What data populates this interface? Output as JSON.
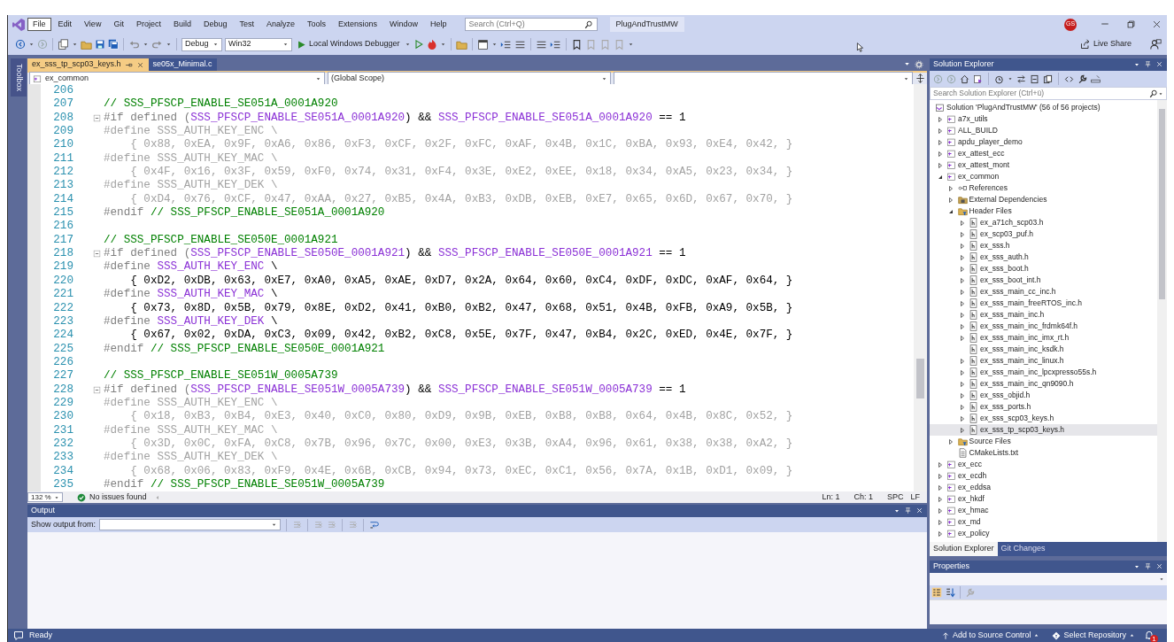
{
  "window": {
    "solution_name": "PlugAndTrustMW",
    "account_initials": "GS"
  },
  "menu": [
    {
      "label": "File",
      "selected": true
    },
    {
      "label": "Edit",
      "selected": false
    },
    {
      "label": "View",
      "selected": false
    },
    {
      "label": "Git",
      "selected": false
    },
    {
      "label": "Project",
      "selected": false
    },
    {
      "label": "Build",
      "selected": false
    },
    {
      "label": "Debug",
      "selected": false
    },
    {
      "label": "Test",
      "selected": false
    },
    {
      "label": "Analyze",
      "selected": false
    },
    {
      "label": "Tools",
      "selected": false
    },
    {
      "label": "Extensions",
      "selected": false
    },
    {
      "label": "Window",
      "selected": false
    },
    {
      "label": "Help",
      "selected": false
    }
  ],
  "search": {
    "placeholder": "Search (Ctrl+Q)"
  },
  "toolbar": {
    "configuration": "Debug",
    "platform": "Win32",
    "run_label": "Local Windows Debugger",
    "live_share": "Live Share"
  },
  "toolbox": {
    "label": "Toolbox"
  },
  "editor": {
    "tabs": [
      {
        "label": "ex_sss_tp_scp03_keys.h",
        "selected": true
      },
      {
        "label": "se05x_Minimal.c",
        "selected": false
      }
    ],
    "navigation": {
      "project": "ex_common",
      "scope": "(Global Scope)"
    },
    "lines": [
      {
        "number": "206",
        "fold": false
      },
      {
        "number": "207",
        "fold": false,
        "segments": [
          {
            "kind": "comment",
            "text": "// SSS_PFSCP_ENABLE_SE051A_0001A920"
          }
        ]
      },
      {
        "number": "208",
        "fold": true,
        "segments": [
          {
            "kind": "directive",
            "text": "#if defined ("
          },
          {
            "kind": "macro",
            "text": "SSS_PFSCP_ENABLE_SE051A_0001A920"
          },
          {
            "kind": "plain",
            "text": ") && "
          },
          {
            "kind": "macro",
            "text": "SSS_PFSCP_ENABLE_SE051A_0001A920"
          },
          {
            "kind": "plain",
            "text": " == 1"
          }
        ]
      },
      {
        "number": "209",
        "fold": false,
        "segments": [
          {
            "kind": "inactive",
            "text": "#define SSS_AUTH_KEY_ENC \\"
          }
        ]
      },
      {
        "number": "210",
        "fold": false,
        "segments": [
          {
            "kind": "inactive",
            "text": "    { 0x88, 0xEA, 0x9F, 0xA6, 0x86, 0xF3, 0xCF, 0x2F, 0xFC, 0xAF, 0x4B, 0x1C, 0xBA, 0x93, 0xE4, 0x42, }"
          }
        ]
      },
      {
        "number": "211",
        "fold": false,
        "segments": [
          {
            "kind": "inactive",
            "text": "#define SSS_AUTH_KEY_MAC \\"
          }
        ]
      },
      {
        "number": "212",
        "fold": false,
        "segments": [
          {
            "kind": "inactive",
            "text": "    { 0x4F, 0x16, 0x3F, 0x59, 0xF0, 0x74, 0x31, 0xF4, 0x3E, 0xE2, 0xEE, 0x18, 0x34, 0xA5, 0x23, 0x34, }"
          }
        ]
      },
      {
        "number": "213",
        "fold": false,
        "segments": [
          {
            "kind": "inactive",
            "text": "#define SSS_AUTH_KEY_DEK \\"
          }
        ]
      },
      {
        "number": "214",
        "fold": false,
        "segments": [
          {
            "kind": "inactive",
            "text": "    { 0xD4, 0x76, 0xCF, 0x47, 0xAA, 0x27, 0xB5, 0x4A, 0xB3, 0xDB, 0xEB, 0xE7, 0x65, 0x6D, 0x67, 0x70, }"
          }
        ]
      },
      {
        "number": "215",
        "fold": false,
        "segments": [
          {
            "kind": "directive",
            "text": "#endif "
          },
          {
            "kind": "comment",
            "text": "// SSS_PFSCP_ENABLE_SE051A_0001A920"
          }
        ]
      },
      {
        "number": "216",
        "fold": false
      },
      {
        "number": "217",
        "fold": false,
        "segments": [
          {
            "kind": "comment",
            "text": "// SSS_PFSCP_ENABLE_SE050E_0001A921"
          }
        ]
      },
      {
        "number": "218",
        "fold": true,
        "segments": [
          {
            "kind": "directive",
            "text": "#if defined ("
          },
          {
            "kind": "macro",
            "text": "SSS_PFSCP_ENABLE_SE050E_0001A921"
          },
          {
            "kind": "plain",
            "text": ") && "
          },
          {
            "kind": "macro",
            "text": "SSS_PFSCP_ENABLE_SE050E_0001A921"
          },
          {
            "kind": "plain",
            "text": " == 1"
          }
        ]
      },
      {
        "number": "219",
        "fold": false,
        "segments": [
          {
            "kind": "directive",
            "text": "#define "
          },
          {
            "kind": "macro",
            "text": "SSS_AUTH_KEY_ENC"
          },
          {
            "kind": "plain",
            "text": " \\"
          }
        ]
      },
      {
        "number": "220",
        "fold": false,
        "segments": [
          {
            "kind": "plain",
            "text": "    { 0xD2, 0xDB, 0x63, 0xE7, 0xA0, 0xA5, 0xAE, 0xD7, 0x2A, 0x64, 0x60, 0xC4, 0xDF, 0xDC, 0xAF, 0x64, }"
          }
        ]
      },
      {
        "number": "221",
        "fold": false,
        "segments": [
          {
            "kind": "directive",
            "text": "#define "
          },
          {
            "kind": "macro",
            "text": "SSS_AUTH_KEY_MAC"
          },
          {
            "kind": "plain",
            "text": " \\"
          }
        ]
      },
      {
        "number": "222",
        "fold": false,
        "segments": [
          {
            "kind": "plain",
            "text": "    { 0x73, 0x8D, 0x5B, 0x79, 0x8E, 0xD2, 0x41, 0xB0, 0xB2, 0x47, 0x68, 0x51, 0x4B, 0xFB, 0xA9, 0x5B, }"
          }
        ]
      },
      {
        "number": "223",
        "fold": false,
        "segments": [
          {
            "kind": "directive",
            "text": "#define "
          },
          {
            "kind": "macro",
            "text": "SSS_AUTH_KEY_DEK"
          },
          {
            "kind": "plain",
            "text": " \\"
          }
        ]
      },
      {
        "number": "224",
        "fold": false,
        "segments": [
          {
            "kind": "plain",
            "text": "    { 0x67, 0x02, 0xDA, 0xC3, 0x09, 0x42, 0xB2, 0xC8, 0x5E, 0x7F, 0x47, 0xB4, 0x2C, 0xED, 0x4E, 0x7F, }"
          }
        ]
      },
      {
        "number": "225",
        "fold": false,
        "segments": [
          {
            "kind": "directive",
            "text": "#endif "
          },
          {
            "kind": "comment",
            "text": "// SSS_PFSCP_ENABLE_SE050E_0001A921"
          }
        ]
      },
      {
        "number": "226",
        "fold": false
      },
      {
        "number": "227",
        "fold": false,
        "segments": [
          {
            "kind": "comment",
            "text": "// SSS_PFSCP_ENABLE_SE051W_0005A739"
          }
        ]
      },
      {
        "number": "228",
        "fold": true,
        "segments": [
          {
            "kind": "directive",
            "text": "#if defined ("
          },
          {
            "kind": "macro",
            "text": "SSS_PFSCP_ENABLE_SE051W_0005A739"
          },
          {
            "kind": "plain",
            "text": ") && "
          },
          {
            "kind": "macro",
            "text": "SSS_PFSCP_ENABLE_SE051W_0005A739"
          },
          {
            "kind": "plain",
            "text": " == 1"
          }
        ]
      },
      {
        "number": "229",
        "fold": false,
        "segments": [
          {
            "kind": "inactive",
            "text": "#define SSS_AUTH_KEY_ENC \\"
          }
        ]
      },
      {
        "number": "230",
        "fold": false,
        "segments": [
          {
            "kind": "inactive",
            "text": "    { 0x18, 0xB3, 0xB4, 0xE3, 0x40, 0xC0, 0x80, 0xD9, 0x9B, 0xEB, 0xB8, 0xB8, 0x64, 0x4B, 0x8C, 0x52, }"
          }
        ]
      },
      {
        "number": "231",
        "fold": false,
        "segments": [
          {
            "kind": "inactive",
            "text": "#define SSS_AUTH_KEY_MAC \\"
          }
        ]
      },
      {
        "number": "232",
        "fold": false,
        "segments": [
          {
            "kind": "inactive",
            "text": "    { 0x3D, 0x0C, 0xFA, 0xC8, 0x7B, 0x96, 0x7C, 0x00, 0xE3, 0x3B, 0xA4, 0x96, 0x61, 0x38, 0x38, 0xA2, }"
          }
        ]
      },
      {
        "number": "233",
        "fold": false,
        "segments": [
          {
            "kind": "inactive",
            "text": "#define SSS_AUTH_KEY_DEK \\"
          }
        ]
      },
      {
        "number": "234",
        "fold": false,
        "segments": [
          {
            "kind": "inactive",
            "text": "    { 0x68, 0x06, 0x83, 0xF9, 0x4E, 0x6B, 0xCB, 0x94, 0x73, 0xEC, 0xC1, 0x56, 0x7A, 0x1B, 0xD1, 0x09, }"
          }
        ]
      },
      {
        "number": "235",
        "fold": false,
        "segments": [
          {
            "kind": "directive",
            "text": "#endif "
          },
          {
            "kind": "comment",
            "text": "// SSS_PFSCP_ENABLE_SE051W_0005A739"
          }
        ]
      }
    ],
    "status": {
      "zoom": "132 %",
      "issues": "No issues found",
      "line": "Ln: 1",
      "column": "Ch: 1",
      "whitespace": "SPC",
      "line_ending": "LF"
    }
  },
  "output": {
    "title": "Output",
    "source_label": "Show output from:"
  },
  "solution_explorer": {
    "title": "Solution Explorer",
    "search_placeholder": "Search Solution Explorer (Ctrl+ü)",
    "tree": [
      {
        "label": "Solution 'PlugAndTrustMW' (56 of 56 projects)",
        "kind": "solution",
        "selected": false,
        "children": [
          {
            "label": "a7x_utils",
            "kind": "project",
            "expanded": false,
            "selected": false
          },
          {
            "label": "ALL_BUILD",
            "kind": "project",
            "expanded": false,
            "selected": false
          },
          {
            "label": "apdu_player_demo",
            "kind": "project",
            "expanded": false,
            "selected": false
          },
          {
            "label": "ex_attest_ecc",
            "kind": "project",
            "expanded": false,
            "selected": false
          },
          {
            "label": "ex_attest_mont",
            "kind": "project",
            "expanded": false,
            "selected": false
          },
          {
            "label": "ex_common",
            "kind": "project",
            "expanded": true,
            "selected": false,
            "children": [
              {
                "label": "References",
                "kind": "references",
                "expanded": false,
                "selected": false
              },
              {
                "label": "External Dependencies",
                "kind": "dependencies",
                "expanded": false,
                "selected": false
              },
              {
                "label": "Header Files",
                "kind": "folder",
                "expanded": true,
                "selected": false,
                "children": [
                  {
                    "label": "ex_a71ch_scp03.h",
                    "kind": "file",
                    "expanded": false,
                    "selected": false
                  },
                  {
                    "label": "ex_scp03_puf.h",
                    "kind": "file",
                    "expanded": false,
                    "selected": false
                  },
                  {
                    "label": "ex_sss.h",
                    "kind": "file",
                    "expanded": false,
                    "selected": false
                  },
                  {
                    "label": "ex_sss_auth.h",
                    "kind": "file",
                    "expanded": false,
                    "selected": false
                  },
                  {
                    "label": "ex_sss_boot.h",
                    "kind": "file",
                    "expanded": false,
                    "selected": false
                  },
                  {
                    "label": "ex_sss_boot_int.h",
                    "kind": "file",
                    "expanded": false,
                    "selected": false
                  },
                  {
                    "label": "ex_sss_main_cc_inc.h",
                    "kind": "file",
                    "expanded": false,
                    "selected": false
                  },
                  {
                    "label": "ex_sss_main_freeRTOS_inc.h",
                    "kind": "file",
                    "expanded": false,
                    "selected": false
                  },
                  {
                    "label": "ex_sss_main_inc.h",
                    "kind": "file",
                    "expanded": false,
                    "selected": false
                  },
                  {
                    "label": "ex_sss_main_inc_frdmk64f.h",
                    "kind": "file",
                    "expanded": false,
                    "selected": false
                  },
                  {
                    "label": "ex_sss_main_inc_imx_rt.h",
                    "kind": "file",
                    "expanded": false,
                    "selected": false
                  },
                  {
                    "label": "ex_sss_main_inc_ksdk.h",
                    "kind": "file",
                    "selected": false
                  },
                  {
                    "label": "ex_sss_main_inc_linux.h",
                    "kind": "file",
                    "expanded": false,
                    "selected": false
                  },
                  {
                    "label": "ex_sss_main_inc_lpcxpresso55s.h",
                    "kind": "file",
                    "expanded": false,
                    "selected": false
                  },
                  {
                    "label": "ex_sss_main_inc_qn9090.h",
                    "kind": "file",
                    "expanded": false,
                    "selected": false
                  },
                  {
                    "label": "ex_sss_objid.h",
                    "kind": "file",
                    "expanded": false,
                    "selected": false
                  },
                  {
                    "label": "ex_sss_ports.h",
                    "kind": "file",
                    "expanded": false,
                    "selected": false
                  },
                  {
                    "label": "ex_sss_scp03_keys.h",
                    "kind": "file",
                    "expanded": false,
                    "selected": false
                  },
                  {
                    "label": "ex_sss_tp_scp03_keys.h",
                    "kind": "file",
                    "expanded": false,
                    "selected": true
                  }
                ]
              },
              {
                "label": "Source Files",
                "kind": "folder",
                "expanded": false,
                "selected": false
              },
              {
                "label": "CMakeLists.txt",
                "kind": "text",
                "selected": false
              }
            ]
          },
          {
            "label": "ex_ecc",
            "kind": "project",
            "expanded": false,
            "selected": false
          },
          {
            "label": "ex_ecdh",
            "kind": "project",
            "expanded": false,
            "selected": false
          },
          {
            "label": "ex_eddsa",
            "kind": "project",
            "expanded": false,
            "selected": false
          },
          {
            "label": "ex_hkdf",
            "kind": "project",
            "expanded": false,
            "selected": false
          },
          {
            "label": "ex_hmac",
            "kind": "project",
            "expanded": false,
            "selected": false
          },
          {
            "label": "ex_md",
            "kind": "project",
            "expanded": false,
            "selected": false
          },
          {
            "label": "ex_policy",
            "kind": "project",
            "expanded": false,
            "selected": false
          }
        ]
      }
    ],
    "tabs": [
      {
        "label": "Solution Explorer",
        "selected": true
      },
      {
        "label": "Git Changes",
        "selected": false
      }
    ]
  },
  "properties": {
    "title": "Properties"
  },
  "status_bar": {
    "message": "Ready",
    "source_control": "Add to Source Control",
    "repository": "Select Repository",
    "notifications": "1"
  }
}
